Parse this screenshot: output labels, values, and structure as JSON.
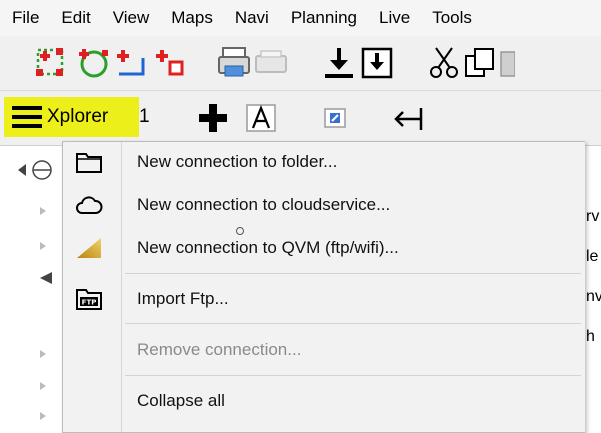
{
  "menubar": {
    "items": [
      "File",
      "Edit",
      "View",
      "Maps",
      "Navi",
      "Planning",
      "Live",
      "Tools"
    ]
  },
  "explorer_tab": {
    "label": "Xplorer",
    "number": "1"
  },
  "context_menu": {
    "items": [
      {
        "label": "New connection to folder...",
        "icon": "folder-icon",
        "enabled": true
      },
      {
        "label": "New connection to cloudservice...",
        "icon": "cloud-icon",
        "enabled": true
      },
      {
        "label": "New connection to QVM (ftp/wifi)...",
        "icon": "qvm-icon",
        "enabled": true
      },
      {
        "label": "Import Ftp...",
        "icon": "ftp-icon",
        "enabled": true
      },
      {
        "label": "Remove connection...",
        "icon": "",
        "enabled": false
      },
      {
        "label": "Collapse all",
        "icon": "",
        "enabled": true
      }
    ]
  },
  "right_panel": {
    "fragments": [
      "rv",
      "le",
      "nv",
      "h"
    ]
  },
  "colors": {
    "highlight": "#ecef1a",
    "red": "#e02020",
    "green": "#2aa02a",
    "blue": "#1e64d2"
  }
}
